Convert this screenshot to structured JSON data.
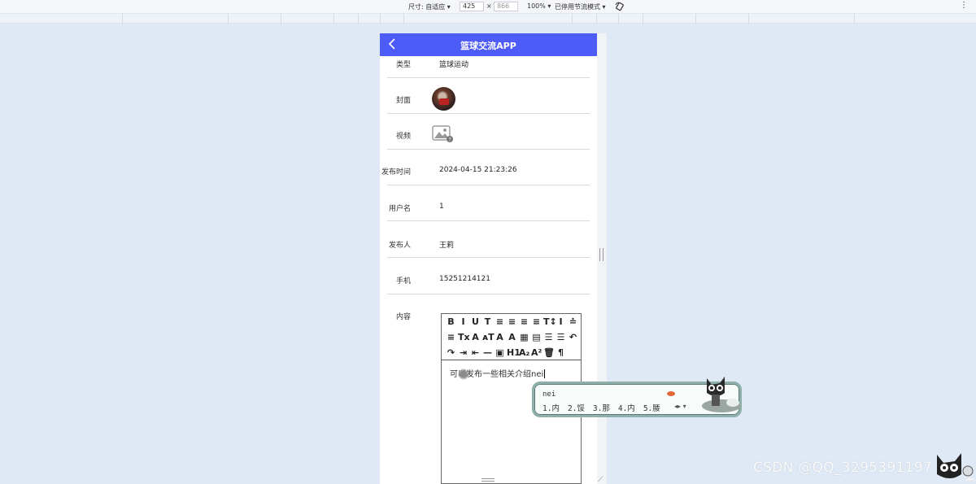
{
  "devtools": {
    "dimension_label": "尺寸: 自适应",
    "width": "425",
    "times": "×",
    "height": "866",
    "zoom": "100%",
    "throttle": "已停用节流模式"
  },
  "app": {
    "title": "篮球交流APP"
  },
  "fields": [
    {
      "label": "类型",
      "value": "篮球运动"
    },
    {
      "label": "封面",
      "value": ""
    },
    {
      "label": "视频",
      "value": ""
    },
    {
      "label": "发布时间",
      "value": "2024-04-15 21:23:26"
    },
    {
      "label": "用户名",
      "value": "1"
    },
    {
      "label": "发布人",
      "value": "王莉"
    },
    {
      "label": "手机",
      "value": "15251214121"
    },
    {
      "label": "内容",
      "value": ""
    }
  ],
  "editor": {
    "text": "可以发布一些相关介绍nei",
    "toolbar_row1": [
      "B",
      "I",
      "U",
      "T",
      "≡",
      "≡",
      "≡",
      "≡",
      "T↕",
      "I",
      "≐"
    ],
    "toolbar_row2": [
      "≡",
      "Tx",
      "A",
      "ᴀT",
      "A",
      "A",
      "▦",
      "▤",
      "☰",
      "☰",
      "↶"
    ],
    "toolbar_row3": [
      "↷",
      "⇥",
      "⇤",
      "—",
      "▣",
      "H1",
      "A₂",
      "A²",
      "🗑",
      "¶"
    ]
  },
  "ime": {
    "composition": "nei",
    "candidates": [
      "1.内",
      "2.馁",
      "3.那",
      "4.内",
      "5.腇"
    ]
  },
  "watermark": "CSDN @QQ_3295391197",
  "colors": {
    "header": "#4d5bf7",
    "background": "#dfe8f5"
  }
}
